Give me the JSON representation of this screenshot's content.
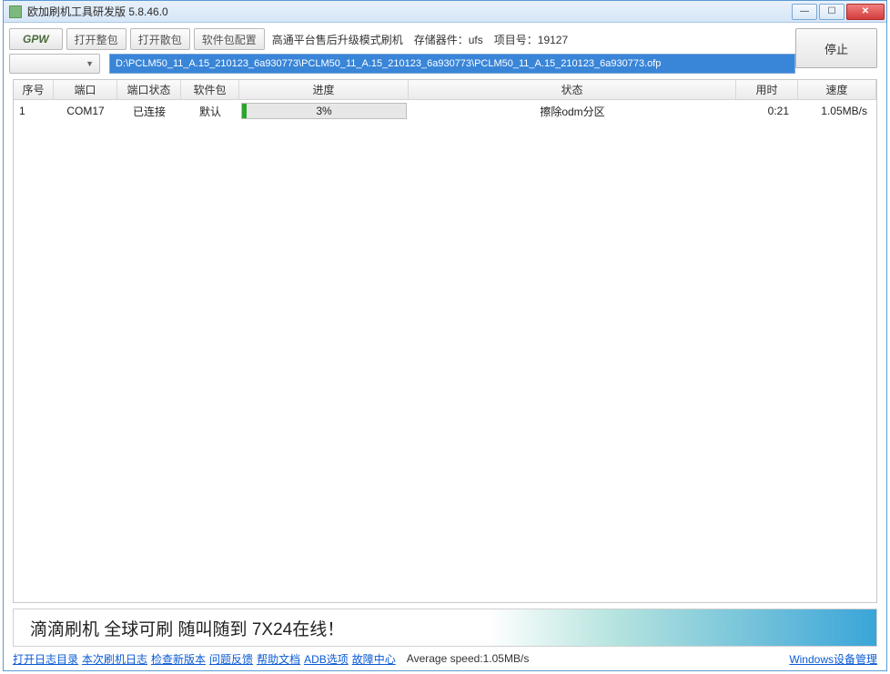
{
  "window": {
    "title": "欧加刷机工具研发版 5.8.46.0"
  },
  "toolbar": {
    "gpw_label": "GPW",
    "open_full_label": "打开整包",
    "open_scatter_label": "打开散包",
    "pkg_config_label": "软件包配置",
    "mode_text": "高通平台售后升级模式刷机",
    "storage_label_prefix": "存储器件：",
    "storage_value": "ufs",
    "project_label_prefix": "项目号：",
    "project_value": "19127",
    "stop_label": "停止",
    "path_value": "D:\\PCLM50_11_A.15_210123_6a930773\\PCLM50_11_A.15_210123_6a930773\\PCLM50_11_A.15_210123_6a930773.ofp"
  },
  "table": {
    "headers": {
      "idx": "序号",
      "port": "端口",
      "port_status": "端口状态",
      "pkg": "软件包",
      "progress": "进度",
      "status": "状态",
      "time": "用时",
      "speed": "速度"
    },
    "rows": [
      {
        "idx": "1",
        "port": "COM17",
        "port_status": "已连接",
        "pkg": "默认",
        "progress_pct": 3,
        "progress_text": "3%",
        "status": "擦除odm分区",
        "time": "0:21",
        "speed": "1.05MB/s"
      }
    ]
  },
  "banner": {
    "text": "滴滴刷机 全球可刷 随叫随到 7X24在线！"
  },
  "footer": {
    "links": {
      "open_log_dir": "打开日志目录",
      "this_log": "本次刷机日志",
      "check_update": "检查新版本",
      "feedback": "问题反馈",
      "help_doc": "帮助文档",
      "adb_options": "ADB选项",
      "fault_center": "故障中心",
      "win_devmgr": "Windows设备管理"
    },
    "avg_speed_label": "Average speed:",
    "avg_speed_value": "1.05MB/s"
  }
}
